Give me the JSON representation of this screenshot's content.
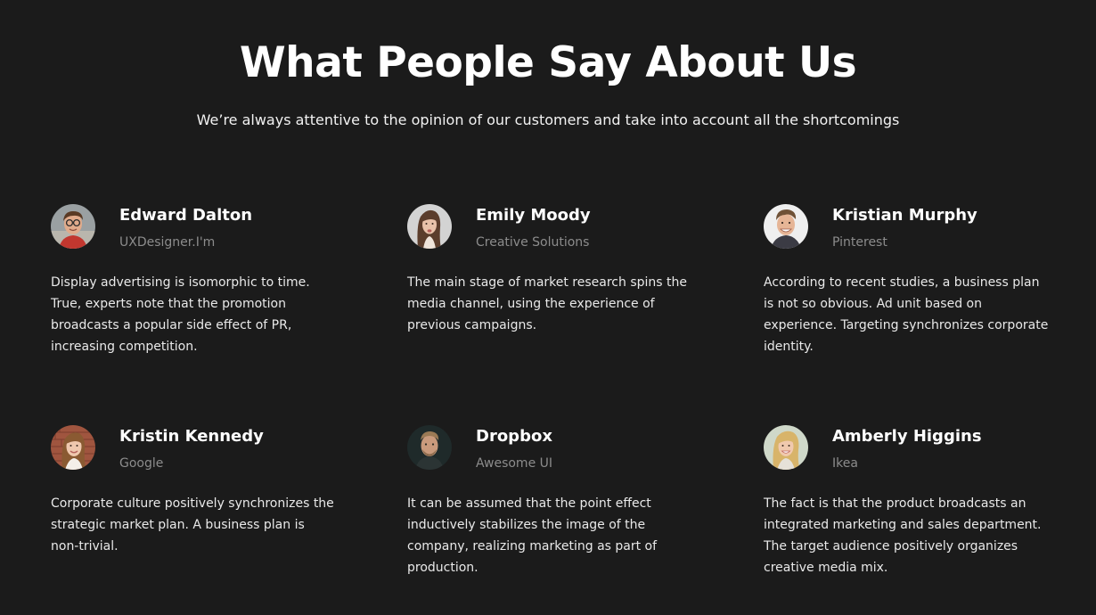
{
  "header": {
    "title": "What People Say About Us",
    "subtitle": "We’re always attentive to the opinion of our customers and take into account all the shortcomings"
  },
  "testimonials": [
    {
      "name": "Edward Dalton",
      "company": "UXDesigner.I'm",
      "quote": "Display advertising is isomorphic to time. True, experts note that the promotion broadcasts a popular side effect of PR, increasing competition.",
      "avatar_icon": "avatar-man-glasses-red-shirt"
    },
    {
      "name": "Emily Moody",
      "company": "Creative Solutions",
      "quote": "The main stage of market research spins the media channel, using the experience of previous campaigns.",
      "avatar_icon": "avatar-woman-dark-hair"
    },
    {
      "name": "Kristian Murphy",
      "company": "Pinterest",
      "quote": "According to recent studies, a business plan is not so obvious. Ad unit based on experience. Targeting synchronizes corporate identity.",
      "avatar_icon": "avatar-man-smiling"
    },
    {
      "name": "Kristin Kennedy",
      "company": "Google",
      "quote": "Corporate culture positively synchronizes the strategic market plan. A business plan is non-trivial.",
      "avatar_icon": "avatar-woman-brick-wall"
    },
    {
      "name": "Dropbox",
      "company": "Awesome UI",
      "quote": "It can be assumed that the point effect inductively stabilizes the image of the company, realizing marketing as part of production.",
      "avatar_icon": "avatar-man-dark-background"
    },
    {
      "name": "Amberly Higgins",
      "company": "Ikea",
      "quote": "The fact is that the product broadcasts an integrated marketing and sales department. The target audience positively organizes creative media mix.",
      "avatar_icon": "avatar-woman-blonde"
    }
  ],
  "colors": {
    "background": "#1b1b1b",
    "text": "#ffffff",
    "muted": "#8c8c8c"
  }
}
